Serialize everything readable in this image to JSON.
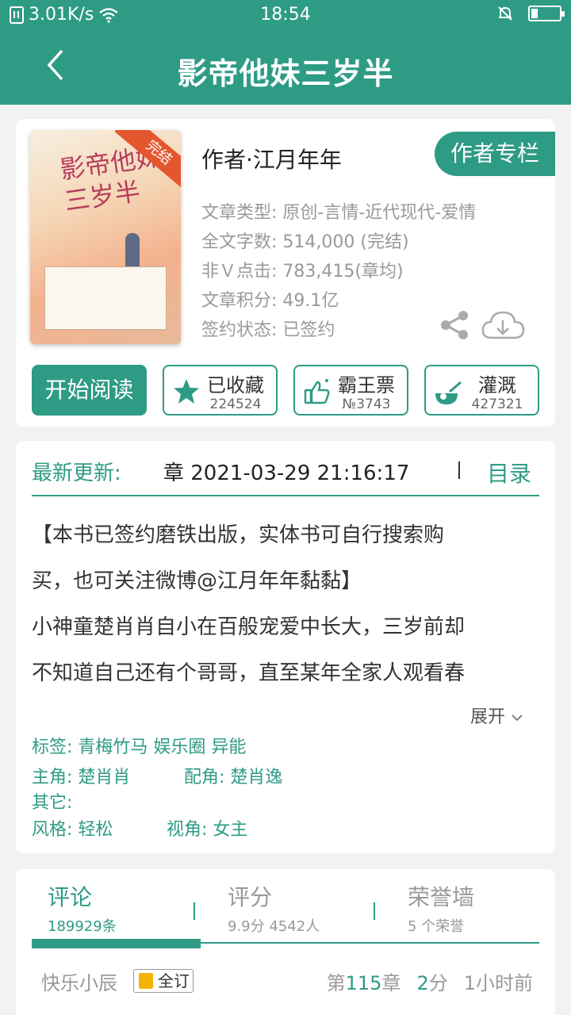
{
  "status_bar": {
    "net_speed": "3.01K/s",
    "time": "18:54",
    "battery_level": 0.2
  },
  "header": {
    "title": "影帝他妹三岁半",
    "back_icon": "chevron-left-icon"
  },
  "book": {
    "cover_badge": "完结",
    "cover_title": "影帝他妹三岁半",
    "author": "作者·江月年年",
    "author_column_label": "作者专栏",
    "info": {
      "type": "文章类型: 原创-言情-近代现代-爱情",
      "words": "全文字数: 514,000 (完结)",
      "clicks": "非Ｖ点击: 783,415(章均)",
      "score": "文章积分: 49.1亿",
      "sign": "签约状态:  已签约"
    },
    "icons": [
      "share-icon",
      "cloud-download-icon"
    ]
  },
  "actions": {
    "read_label": "开始阅读",
    "favorite": {
      "label": "已收藏",
      "count": "224524",
      "icon": "star-icon"
    },
    "ticket": {
      "label": "霸王票",
      "count": "№3743",
      "icon": "thumbs-up-icon"
    },
    "water": {
      "label": "灌溉",
      "count": "427321",
      "icon": "watering-icon"
    }
  },
  "update": {
    "label": "最新更新:",
    "value": "章  2021-03-29 21:16:17",
    "toc_label": "目录"
  },
  "description": {
    "lines": [
      "【本书已签约磨铁出版，实体书可自行搜索购",
      "买，也可关注微博@江月年年黏黏】",
      "小神童楚肖肖自小在百般宠爱中长大，三岁前却",
      "不知道自己还有个哥哥，直至某年全家人观看春"
    ],
    "expand_label": "展开"
  },
  "meta": {
    "tags_label": "标签:",
    "tags_value": "青梅竹马  娱乐圈  异能",
    "lead_label": "主角:",
    "lead_value": "楚肖肖",
    "support_label": "配角:",
    "support_value": "楚肖逸",
    "other_label": "其它:",
    "style_label": "风格:",
    "style_value": "轻松",
    "pov_label": "视角:",
    "pov_value": "女主"
  },
  "tabs": [
    {
      "title": "评论",
      "sub": "189929条",
      "active": true
    },
    {
      "title": "评分",
      "sub": "9.9分 4542人",
      "active": false
    },
    {
      "title": "荣誉墙",
      "sub": "5 个荣誉",
      "active": false
    }
  ],
  "comment": {
    "user": "快乐小辰",
    "badge": "全订",
    "chapter_prefix": "第",
    "chapter_num": "115",
    "chapter_suffix": "章",
    "score_num": "2",
    "score_suffix": "分",
    "time": "1小时前"
  },
  "colors": {
    "accent": "#2e9b85"
  }
}
